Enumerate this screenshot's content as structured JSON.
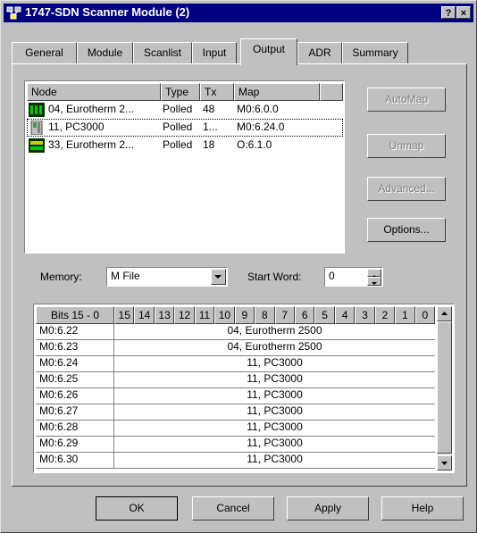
{
  "window": {
    "title": "1747-SDN Scanner Module (2)",
    "help_btn": "?",
    "close_btn": "×"
  },
  "tabs": [
    "General",
    "Module",
    "Scanlist",
    "Input",
    "Output",
    "ADR",
    "Summary"
  ],
  "active_tab": "Output",
  "node_list": {
    "columns": [
      "Node",
      "Type",
      "Tx",
      "Map"
    ],
    "rows": [
      {
        "icon": "eurotherm-icon",
        "node": "04, Eurotherm 2...",
        "type": "Polled",
        "tx": "48",
        "map": "M0:6.0.0"
      },
      {
        "icon": "pc3000-icon",
        "node": "11, PC3000",
        "type": "Polled",
        "tx": "1...",
        "map": "M0:6.24.0"
      },
      {
        "icon": "eurotherm-icon",
        "node": "33, Eurotherm 2...",
        "type": "Polled",
        "tx": "18",
        "map": "O:6.1.0"
      }
    ]
  },
  "side_buttons": {
    "automap": "AutoMap",
    "unmap": "Unmap",
    "advanced": "Advanced...",
    "options": "Options..."
  },
  "memory": {
    "label": "Memory:",
    "value": "M File"
  },
  "start_word": {
    "label": "Start Word:",
    "value": "0"
  },
  "bit_grid": {
    "header_first": "Bits 15 - 0",
    "bit_headers": [
      "15",
      "14",
      "13",
      "12",
      "11",
      "10",
      "9",
      "8",
      "7",
      "6",
      "5",
      "4",
      "3",
      "2",
      "1",
      "0"
    ],
    "rows": [
      {
        "addr": "M0:6.22",
        "value": "04, Eurotherm 2500"
      },
      {
        "addr": "M0:6.23",
        "value": "04, Eurotherm 2500"
      },
      {
        "addr": "M0:6.24",
        "value": "11, PC3000"
      },
      {
        "addr": "M0:6.25",
        "value": "11, PC3000"
      },
      {
        "addr": "M0:6.26",
        "value": "11, PC3000"
      },
      {
        "addr": "M0:6.27",
        "value": "11, PC3000"
      },
      {
        "addr": "M0:6.28",
        "value": "11, PC3000"
      },
      {
        "addr": "M0:6.29",
        "value": "11, PC3000"
      },
      {
        "addr": "M0:6.30",
        "value": "11, PC3000"
      }
    ]
  },
  "footer": {
    "ok": "OK",
    "cancel": "Cancel",
    "apply": "Apply",
    "help": "Help"
  },
  "colors": {
    "titlebar": "#000080",
    "face": "#c0c0c0",
    "selection_border": "#000000"
  }
}
